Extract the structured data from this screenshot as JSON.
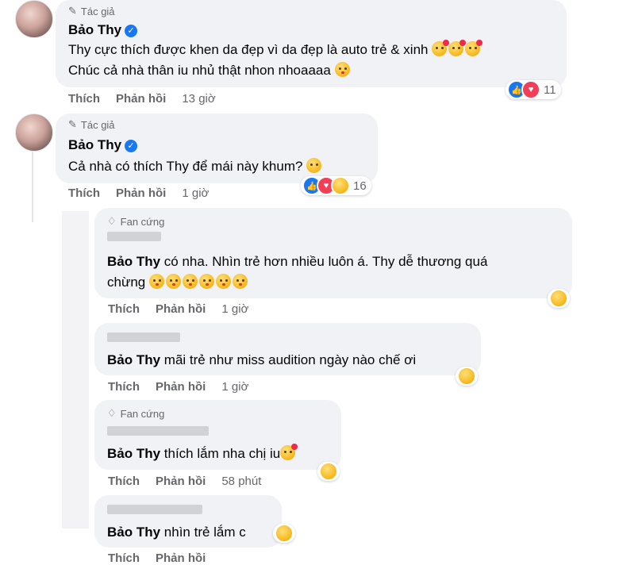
{
  "comments": [
    {
      "badge": "Tác giả",
      "author": "Bảo Thy",
      "lines": [
        "Thy cực thích được khen da đẹp vì da đẹp là auto trẻ & xinh",
        "Chúc cả nhà thân iu nhủ thật nhon nhoaaaa"
      ],
      "like": "Thích",
      "reply": "Phản hồi",
      "time": "13 giờ",
      "reaction_count": "11"
    },
    {
      "badge": "Tác giả",
      "author": "Bảo Thy",
      "lines": [
        "Cả nhà có thích Thy để mái này khum?"
      ],
      "like": "Thích",
      "reply": "Phản hồi",
      "time": "1 giờ",
      "reaction_count": "16"
    }
  ],
  "replies": [
    {
      "badge": "Fan cứng",
      "mention": "Bảo Thy",
      "line1": " có nha. Nhìn trẻ hơn nhiều luôn á. Thy dễ thương quá",
      "line2": "chừng",
      "like": "Thích",
      "reply": "Phản hồi",
      "time": "1 giờ"
    },
    {
      "mention": "Bảo Thy",
      "line1": " mãi trẻ như miss audition ngày nào chế ơi",
      "like": "Thích",
      "reply": "Phản hồi",
      "time": "1 giờ"
    },
    {
      "badge": "Fan cứng",
      "mention": "Bảo Thy",
      "line1": " thích lắm nha chị iu",
      "like": "Thích",
      "reply": "Phản hồi",
      "time": "58 phút"
    },
    {
      "mention": "Bảo Thy",
      "line1": " nhìn trẻ lắm c",
      "like": "Thích",
      "reply": "Phản hồi",
      "time": ""
    }
  ],
  "icons": {
    "author_badge": "pen-icon",
    "fan_badge": "diamond-icon",
    "verified": "verified-check-icon"
  },
  "colors": {
    "bubble": "#f0f2f5",
    "secondary_text": "#65676b",
    "verified_blue": "#1877f2",
    "love_red": "#f33e58"
  }
}
